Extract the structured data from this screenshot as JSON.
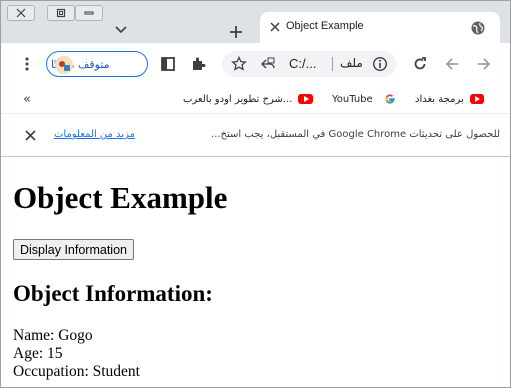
{
  "tab": {
    "title": "Object Example"
  },
  "toolbar": {
    "profile_label": "متوقف مؤقتًا",
    "url": "C:/...",
    "scheme_label": "ملف"
  },
  "bookmarks": {
    "overflow": "«",
    "items": [
      {
        "label": "شرح تطوير اودو بالعرب...",
        "icon": "youtube-icon"
      },
      {
        "label": "YouTube",
        "icon": "youtube-icon"
      },
      {
        "label": "",
        "icon": "google-icon"
      },
      {
        "label": "برمجة بغداد",
        "icon": "youtube-icon"
      }
    ]
  },
  "infobar": {
    "text": "للحصول على تحديثات Google Chrome في المستقبل، يجب استخ...",
    "link": "مزيد من المعلومات"
  },
  "page": {
    "heading": "Object Example",
    "button_label": "Display Information",
    "subheading": "Object Information:",
    "name_line": "Name: Gogo",
    "age_line": "Age: 15",
    "occupation_line": "Occupation: Student"
  },
  "colors": {
    "tabstrip": "#dee1e6",
    "accent": "#1a73e8",
    "youtube": "#ff0000"
  }
}
